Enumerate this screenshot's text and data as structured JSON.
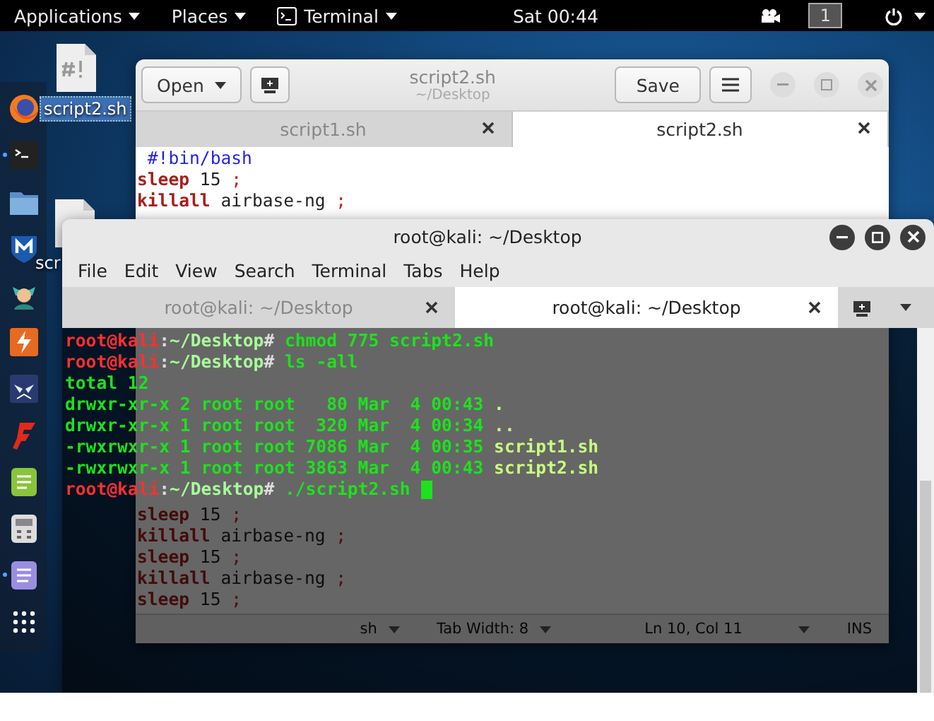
{
  "top_bar": {
    "menus": [
      {
        "label": "Applications",
        "kind": "menu"
      },
      {
        "label": "Places",
        "kind": "menu"
      },
      {
        "label": "Terminal",
        "kind": "app"
      }
    ],
    "clock": "Sat 00:44",
    "workspace": "1"
  },
  "desktop_icons": [
    {
      "label": "script2.sh",
      "selected": true
    },
    {
      "label": "scr",
      "selected": false
    }
  ],
  "dock": [
    {
      "kind": "browser",
      "running": false
    },
    {
      "kind": "terminal",
      "running": true
    },
    {
      "kind": "folder",
      "running": false
    },
    {
      "kind": "shield",
      "running": false
    },
    {
      "kind": "figure",
      "running": false
    },
    {
      "kind": "bolt",
      "running": false
    },
    {
      "kind": "mask",
      "running": false
    },
    {
      "kind": "flame",
      "running": false
    },
    {
      "kind": "notes",
      "running": false
    },
    {
      "kind": "calculator",
      "running": false
    },
    {
      "kind": "document",
      "running": true
    },
    {
      "kind": "grid",
      "running": false
    }
  ],
  "editor": {
    "title": "script2.sh",
    "subtitle": "~/Desktop",
    "open_label": "Open",
    "save_label": "Save",
    "tabs": [
      {
        "label": "script1.sh",
        "selected": false
      },
      {
        "label": "script2.sh",
        "selected": true
      }
    ],
    "top_lines": [
      [
        {
          "kind": "shebang",
          "text": " #!bin/bash"
        }
      ],
      [
        {
          "kind": "keyword",
          "text": "sleep"
        },
        {
          "kind": "plain",
          "text": " 15 "
        },
        {
          "kind": "punct",
          "text": ";"
        }
      ],
      [
        {
          "kind": "keyword",
          "text": "killall"
        },
        {
          "kind": "plain",
          "text": " airbase-ng "
        },
        {
          "kind": "punct",
          "text": ";"
        }
      ]
    ],
    "bottom_lines": [
      [
        {
          "kind": "keyword",
          "text": "sleep"
        },
        {
          "kind": "plain",
          "text": " 15 "
        },
        {
          "kind": "punct",
          "text": ";"
        }
      ],
      [
        {
          "kind": "keyword",
          "text": "killall"
        },
        {
          "kind": "plain",
          "text": " airbase-ng "
        },
        {
          "kind": "punct",
          "text": ";"
        }
      ],
      [
        {
          "kind": "keyword",
          "text": "sleep"
        },
        {
          "kind": "plain",
          "text": " 15 "
        },
        {
          "kind": "punct",
          "text": ";"
        }
      ],
      [
        {
          "kind": "keyword",
          "text": "killall"
        },
        {
          "kind": "plain",
          "text": " airbase-ng "
        },
        {
          "kind": "punct",
          "text": ";"
        }
      ],
      [
        {
          "kind": "keyword",
          "text": "sleep"
        },
        {
          "kind": "plain",
          "text": " 15 "
        },
        {
          "kind": "punct",
          "text": ";"
        }
      ]
    ],
    "status": {
      "language": "sh",
      "tab_width": "Tab Width: 8",
      "position": "Ln 10, Col 11",
      "mode": "INS"
    }
  },
  "terminal": {
    "title": "root@kali: ~/Desktop",
    "menus": [
      "File",
      "Edit",
      "View",
      "Search",
      "Terminal",
      "Tabs",
      "Help"
    ],
    "tabs": [
      {
        "label": "root@kali: ~/Desktop",
        "selected": false
      },
      {
        "label": "root@kali: ~/Desktop",
        "selected": true
      }
    ],
    "lines": [
      {
        "kind": "prompt",
        "user": "root@kali",
        "colon": ":",
        "path": "~/Desktop",
        "sign": "#",
        "command": " chmod 775 script2.sh",
        "cursor": false
      },
      {
        "kind": "prompt",
        "user": "root@kali",
        "colon": ":",
        "path": "~/Desktop",
        "sign": "#",
        "command": " ls -all",
        "cursor": false
      },
      {
        "kind": "output",
        "text": "total 12"
      },
      {
        "kind": "listing",
        "text": "drwxr-xr-x 2 root root   80 Mar  4 00:43 ",
        "name": "."
      },
      {
        "kind": "listing",
        "text": "drwxr-xr-x 1 root root  320 Mar  4 00:34 ",
        "name": ".."
      },
      {
        "kind": "listing",
        "text": "-rwxrwxr-x 1 root root 7086 Mar  4 00:35 ",
        "name": "script1.sh"
      },
      {
        "kind": "listing",
        "text": "-rwxrwxr-x 1 root root 3863 Mar  4 00:43 ",
        "name": "script2.sh"
      },
      {
        "kind": "prompt",
        "user": "root@kali",
        "colon": ":",
        "path": "~/Desktop",
        "sign": "#",
        "command": " ./script2.sh ",
        "cursor": true
      }
    ]
  }
}
